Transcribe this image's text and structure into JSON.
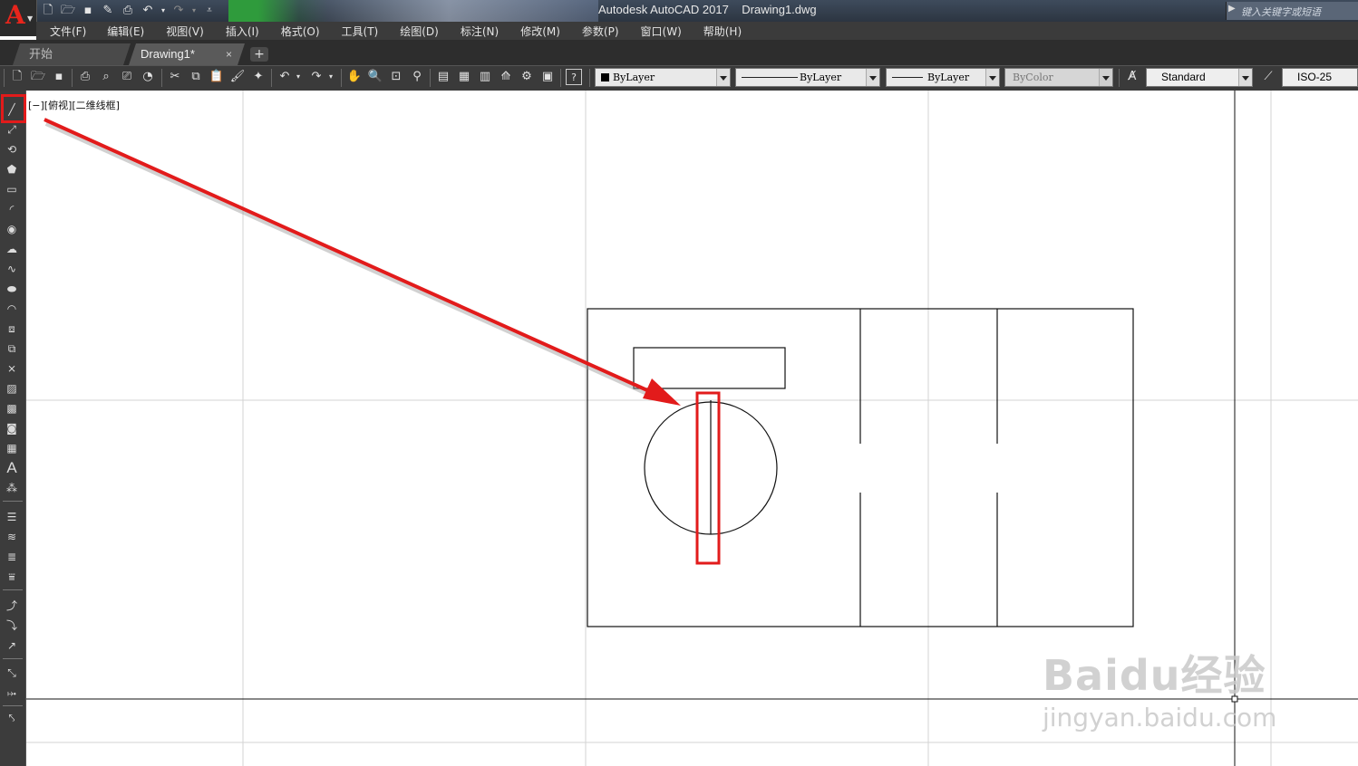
{
  "window": {
    "title": "Autodesk AutoCAD 2017    Drawing1.dwg"
  },
  "search": {
    "placeholder": "键入关键字或短语"
  },
  "app_button": {
    "letter": "A"
  },
  "menu": [
    "文件(F)",
    "编辑(E)",
    "视图(V)",
    "插入(I)",
    "格式(O)",
    "工具(T)",
    "绘图(D)",
    "标注(N)",
    "修改(M)",
    "参数(P)",
    "窗口(W)",
    "帮助(H)"
  ],
  "tabs": [
    {
      "label": "开始",
      "active": false
    },
    {
      "label": "Drawing1*",
      "active": true,
      "close": "×"
    }
  ],
  "tab_add": "+",
  "properties": {
    "color": "ByLayer",
    "linetype": "ByLayer",
    "lineweight": "ByLayer",
    "plotstyle": "ByColor",
    "text_style": "Standard",
    "dim_style": "ISO-25"
  },
  "viewport": {
    "label": "[−][俯视][二维线框]"
  },
  "left_toolbar": {
    "text_tool_glyph": "A"
  },
  "watermark": {
    "logo": "Baidu经验",
    "url": "jingyan.baidu.com"
  },
  "colors": {
    "highlight": "#e21b1b",
    "canvas": "#ffffff",
    "chrome": "#3b3b3b"
  }
}
